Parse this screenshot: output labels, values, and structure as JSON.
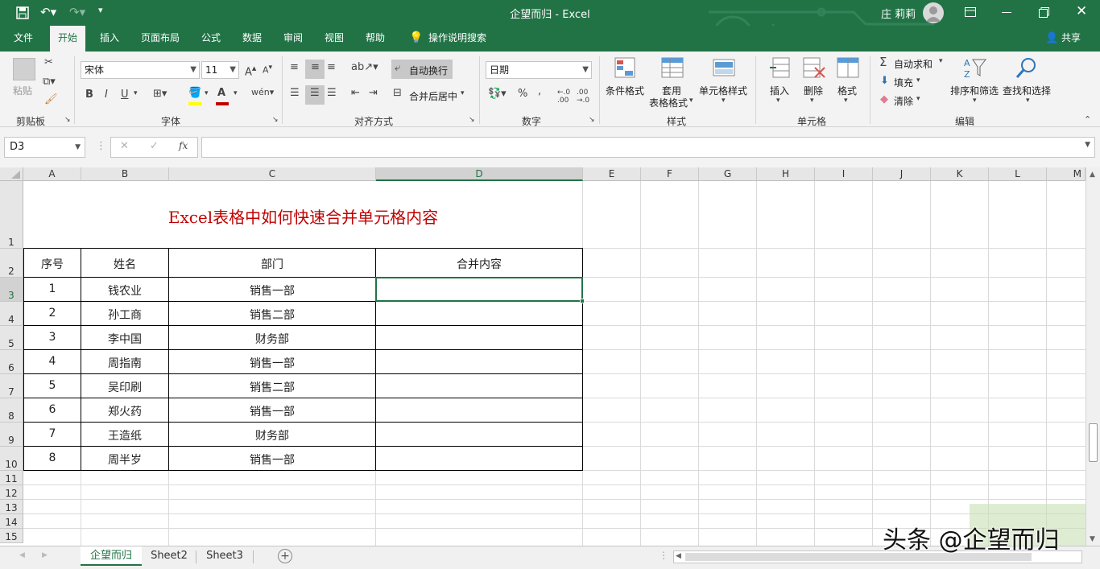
{
  "titlebar": {
    "doc_title": "企望而归 - Excel",
    "user": "庄 莉莉",
    "window_buttons": [
      "ribbon-display-icon",
      "minimize-icon",
      "restore-icon",
      "close-icon"
    ],
    "quick_access": [
      "save-icon",
      "undo-icon",
      "redo-icon",
      "customize-icon"
    ]
  },
  "tabs": [
    "文件",
    "开始",
    "插入",
    "页面布局",
    "公式",
    "数据",
    "审阅",
    "视图",
    "帮助"
  ],
  "tell_me": "操作说明搜索",
  "share": "共享",
  "ribbon": {
    "clipboard": {
      "group": "剪贴板",
      "paste": "粘贴"
    },
    "font": {
      "group": "字体",
      "name": "宋体",
      "size": "11",
      "bold": "B",
      "italic": "I",
      "underline": "U"
    },
    "align": {
      "group": "对齐方式",
      "wrap": "自动换行",
      "merge": "合并后居中"
    },
    "number": {
      "group": "数字",
      "format": "日期",
      "percent": "%",
      "comma": ","
    },
    "styles": {
      "group": "样式",
      "cond": "条件格式",
      "table1": "套用",
      "table2": "表格格式",
      "cell": "单元格样式"
    },
    "cells": {
      "group": "单元格",
      "insert": "插入",
      "delete": "删除",
      "format": "格式"
    },
    "editing": {
      "group": "编辑",
      "autosum": "自动求和",
      "fill": "填充",
      "clear": "清除",
      "sort": "排序和筛选",
      "find": "查找和选择"
    }
  },
  "formula": {
    "name_box": "D3",
    "fx": "fx",
    "cancel": "✕",
    "enter": "✓",
    "value": ""
  },
  "sheet": {
    "columns": [
      "A",
      "B",
      "C",
      "D",
      "E",
      "F",
      "G",
      "H",
      "I",
      "J",
      "K",
      "L",
      "M"
    ],
    "rows": [
      "1",
      "2",
      "3",
      "4",
      "5",
      "6",
      "7",
      "8",
      "9",
      "10",
      "11",
      "12",
      "13",
      "14",
      "15"
    ],
    "selected_cell": "D3",
    "title": "Excel表格中如何快速合并单元格内容",
    "headers": [
      "序号",
      "姓名",
      "部门",
      "合并内容"
    ],
    "data": [
      [
        "1",
        "钱农业",
        "销售一部",
        ""
      ],
      [
        "2",
        "孙工商",
        "销售二部",
        ""
      ],
      [
        "3",
        "李中国",
        "财务部",
        ""
      ],
      [
        "4",
        "周指南",
        "销售一部",
        ""
      ],
      [
        "5",
        "吴印刷",
        "销售二部",
        ""
      ],
      [
        "6",
        "郑火药",
        "销售一部",
        ""
      ],
      [
        "7",
        "王造纸",
        "财务部",
        ""
      ],
      [
        "8",
        "周半岁",
        "销售一部",
        ""
      ]
    ]
  },
  "sheet_tabs": [
    "企望而归",
    "Sheet2",
    "Sheet3"
  ],
  "active_sheet": "企望而归",
  "watermark": "头条 @企望而归",
  "colors": {
    "excel_green": "#217346",
    "title_red": "#c00000"
  }
}
